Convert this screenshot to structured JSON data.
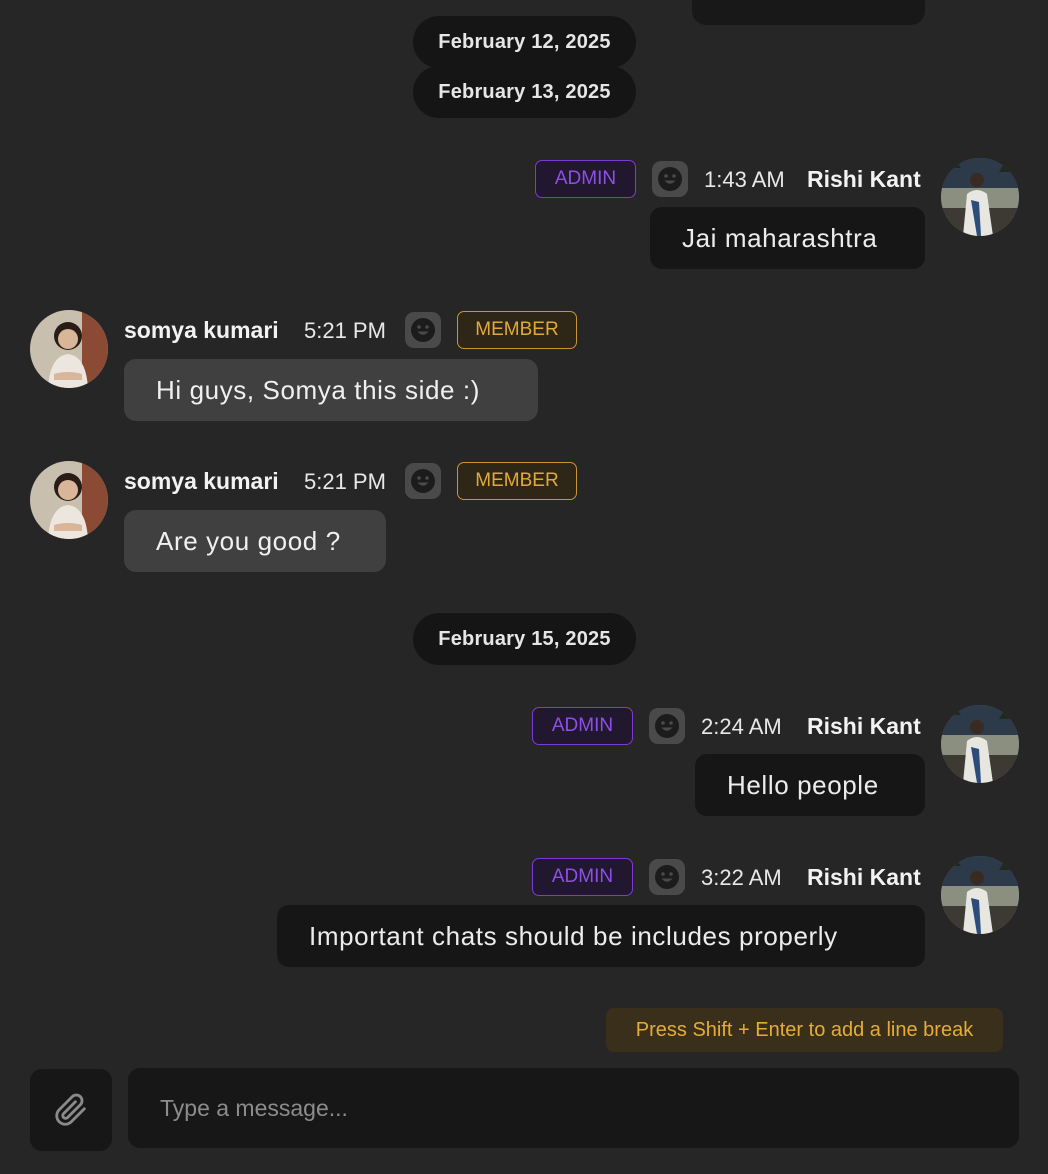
{
  "dates": {
    "d1": "February 12, 2025",
    "d2": "February 13, 2025",
    "d3": "February 15, 2025"
  },
  "messages": [
    {
      "sender": "Rishi Kant",
      "time": "1:43 AM",
      "role": "ADMIN",
      "text": "Jai maharashtra",
      "side": "right",
      "reaction_icon": "smile-icon"
    },
    {
      "sender": "somya kumari",
      "time": "5:21 PM",
      "role": "MEMBER",
      "text": "Hi guys, Somya this side :)",
      "side": "left",
      "reaction_icon": "smile-icon"
    },
    {
      "sender": "somya kumari",
      "time": "5:21 PM",
      "role": "MEMBER",
      "text": "Are you good ?",
      "side": "left",
      "reaction_icon": "smile-icon"
    },
    {
      "sender": "Rishi Kant",
      "time": "2:24 AM",
      "role": "ADMIN",
      "text": "Hello people",
      "side": "right",
      "reaction_icon": "smile-icon"
    },
    {
      "sender": "Rishi Kant",
      "time": "3:22 AM",
      "role": "ADMIN",
      "text": "Important chats should be includes properly",
      "side": "right",
      "reaction_icon": "smile-icon"
    }
  ],
  "composer": {
    "hint": "Press Shift + Enter to add a line break",
    "placeholder": "Type a message...",
    "attach_icon": "paperclip-icon"
  },
  "colors": {
    "background": "#262626",
    "admin_accent": "#8f4fe6",
    "member_accent": "#e2a93a",
    "hint_text": "#e5ad38"
  }
}
